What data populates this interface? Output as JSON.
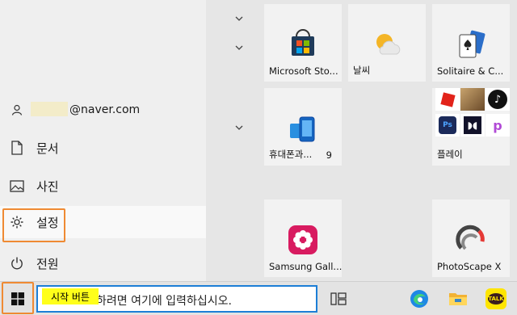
{
  "left_rail": {
    "account_email": "@naver.com",
    "documents_label": "문서",
    "pictures_label": "사진",
    "settings_label": "설정",
    "power_label": "전원"
  },
  "tiles": {
    "store": "Microsoft Sto...",
    "weather": "날씨",
    "solitaire": "Solitaire & C...",
    "phone": "휴대폰과...",
    "phone_badge": "9",
    "play": "플레이",
    "samsung": "Samsung Gall...",
    "photoscape": "PhotoScape X"
  },
  "taskbar": {
    "search_text": "하려면 여기에 입력하십시오.",
    "start_highlight": "시작 버튼"
  },
  "colors": {
    "accent_blue": "#1c7ed6",
    "callout_orange": "#ef8a33",
    "highlight_yellow": "#ffff1a"
  }
}
